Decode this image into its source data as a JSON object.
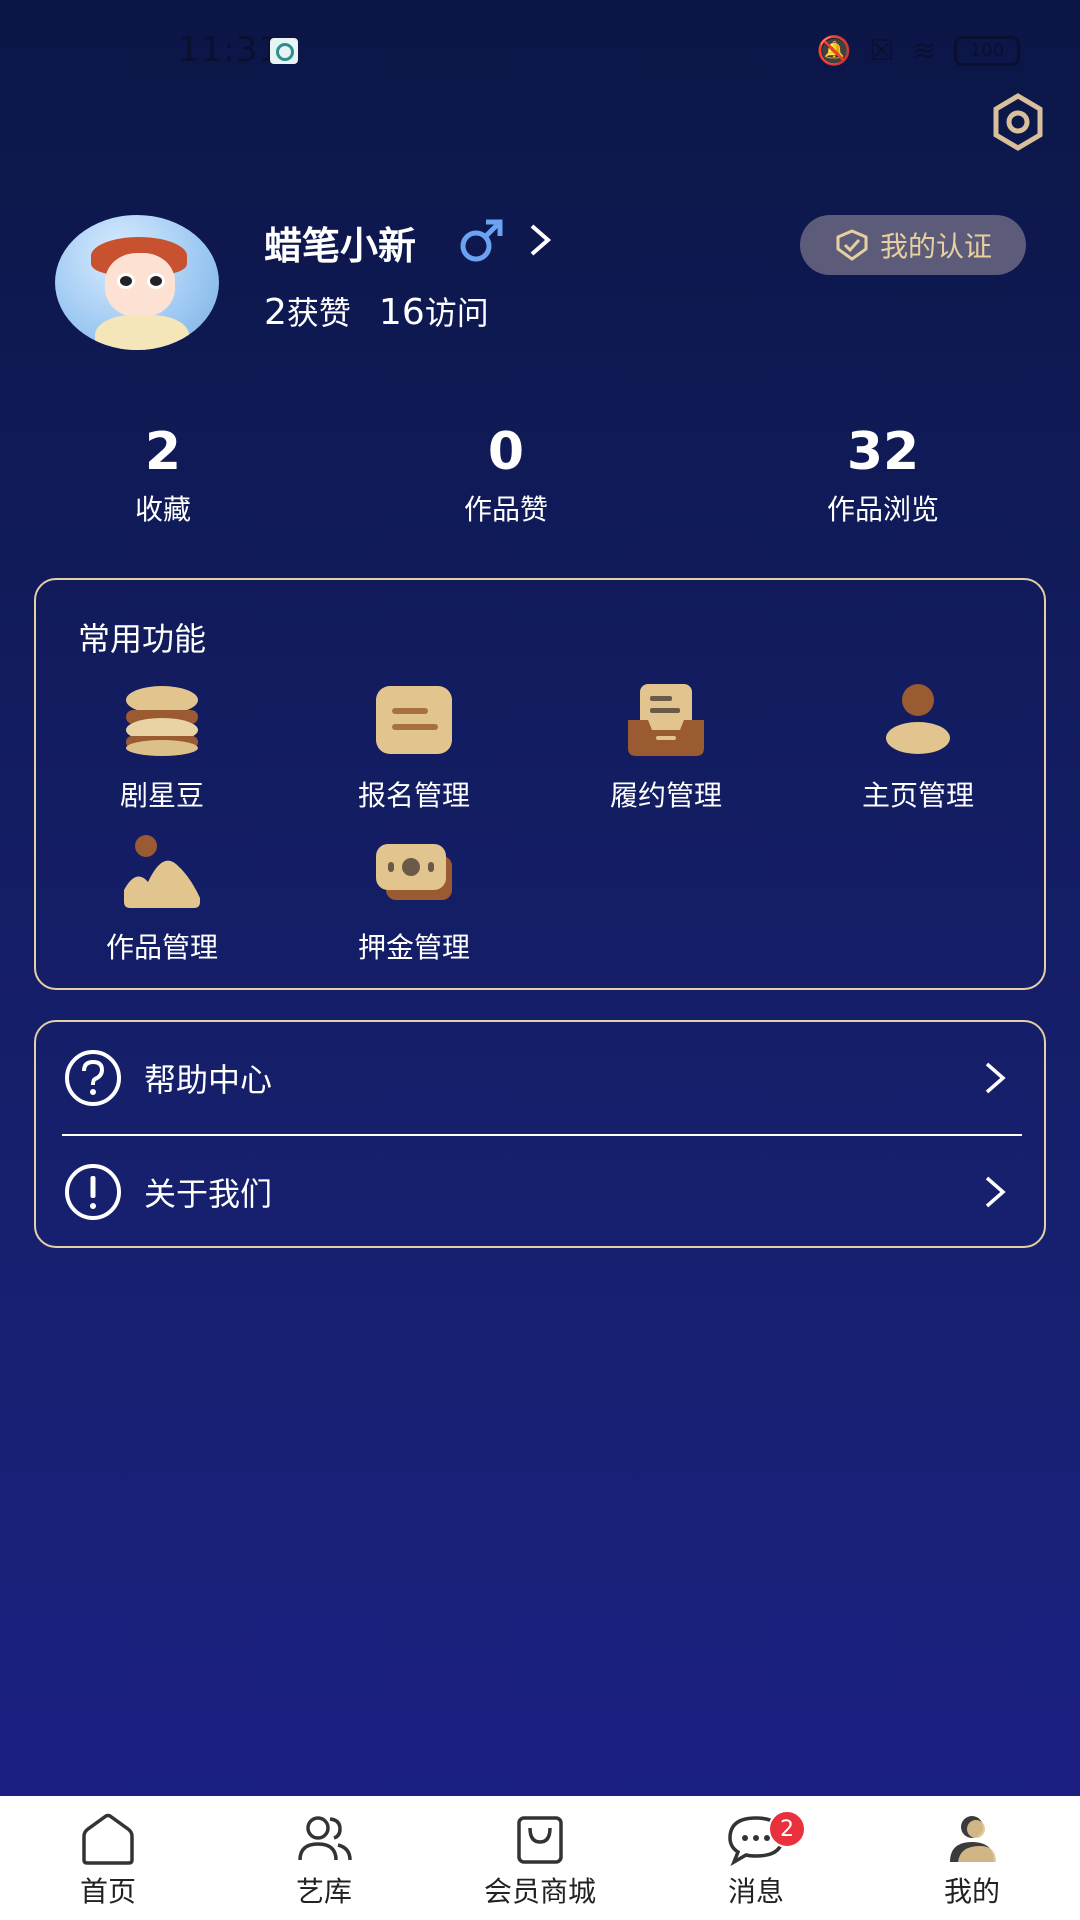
{
  "status_bar": {
    "time": "11:31",
    "battery": "100"
  },
  "profile": {
    "username": "蜡笔小新",
    "likes_count": "2",
    "likes_label": "获赞",
    "visits_count": "16",
    "visits_label": "访问",
    "cert_label": "我的认证"
  },
  "stats": [
    {
      "value": "2",
      "label": "收藏"
    },
    {
      "value": "0",
      "label": "作品赞"
    },
    {
      "value": "32",
      "label": "作品浏览"
    }
  ],
  "functions": {
    "title": "常用功能",
    "items": [
      {
        "label": "剧星豆",
        "icon": "coin-stack-icon"
      },
      {
        "label": "报名管理",
        "icon": "signup-card-icon"
      },
      {
        "label": "履约管理",
        "icon": "inbox-tray-icon"
      },
      {
        "label": "主页管理",
        "icon": "person-icon"
      },
      {
        "label": "作品管理",
        "icon": "landscape-image-icon"
      },
      {
        "label": "押金管理",
        "icon": "cash-icon"
      }
    ]
  },
  "list": [
    {
      "label": "帮助中心",
      "icon": "help-circle-icon"
    },
    {
      "label": "关于我们",
      "icon": "info-circle-icon"
    }
  ],
  "tabs": [
    {
      "label": "首页",
      "icon": "home-icon"
    },
    {
      "label": "艺库",
      "icon": "people-icon"
    },
    {
      "label": "会员商城",
      "icon": "shopping-bag-icon"
    },
    {
      "label": "消息",
      "icon": "chat-bubble-icon",
      "badge": "2"
    },
    {
      "label": "我的",
      "icon": "profile-icon",
      "active": true
    }
  ],
  "colors": {
    "accent_gold": "#e5cfa7",
    "badge_red": "#e8313d",
    "background_top": "#0b1646",
    "background_bottom": "#1b1f86"
  }
}
